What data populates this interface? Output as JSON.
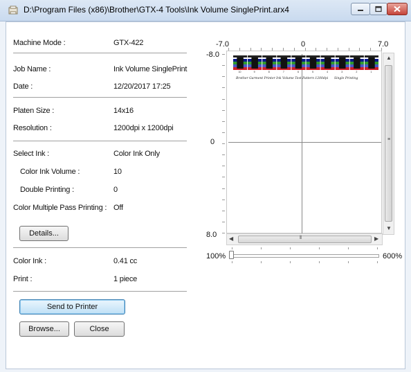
{
  "window": {
    "title": "D:\\Program Files (x86)\\Brother\\GTX-4 Tools\\Ink Volume SinglePrint.arx4"
  },
  "info": {
    "machine_mode_label": "Machine Mode :",
    "machine_mode_value": "GTX-422",
    "job_name_label": "Job Name :",
    "job_name_value": "Ink Volume SinglePrint",
    "date_label": "Date :",
    "date_value": "12/20/2017 17:25",
    "platen_size_label": "Platen Size :",
    "platen_size_value": "14x16",
    "resolution_label": "Resolution :",
    "resolution_value": "1200dpi x 1200dpi",
    "select_ink_label": "Select Ink :",
    "select_ink_value": "Color Ink Only",
    "color_ink_volume_label": "Color Ink Volume :",
    "color_ink_volume_value": "10",
    "double_printing_label": "Double Printing :",
    "double_printing_value": "0",
    "multipass_label": "Color Multiple Pass Printing :",
    "multipass_value": "Off",
    "color_ink_label": "Color Ink :",
    "color_ink_value": "0.41 cc",
    "print_label": "Print :",
    "print_value": "1 piece"
  },
  "buttons": {
    "details": "Details...",
    "send_to_printer": "Send to Printer",
    "browse": "Browse...",
    "close": "Close"
  },
  "preview": {
    "x_min": "-7.0",
    "x_mid": "0",
    "x_max": "7.0",
    "y_min": "-8.0",
    "y_mid": "0",
    "y_max": "8.0",
    "caption_left": "Brother Garment Printer Ink Volume Test Pattern 1200dpi",
    "caption_right": "Single Printing",
    "pattern_numbers": [
      "10",
      "9",
      "8",
      "7",
      "6",
      "5",
      "4",
      "3",
      "2",
      "1"
    ]
  },
  "zoom": {
    "min_label": "100%",
    "max_label": "600%",
    "current_percent": 100
  },
  "colors": {
    "titlebar": "#c9daef",
    "close_button": "#c5443a",
    "send_button": "#bfe0f6"
  }
}
